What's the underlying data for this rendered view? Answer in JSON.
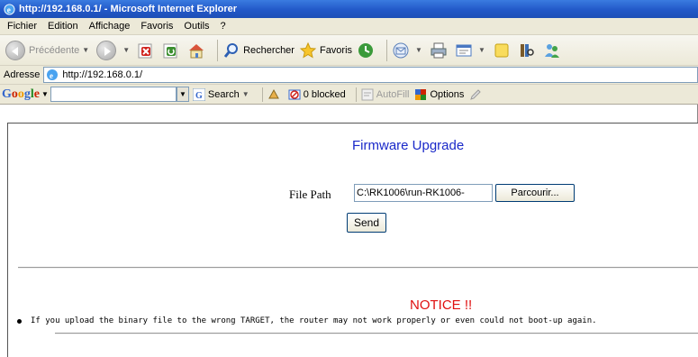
{
  "window": {
    "title": "http://192.168.0.1/ - Microsoft Internet Explorer"
  },
  "menu": {
    "items": [
      "Fichier",
      "Edition",
      "Affichage",
      "Favoris",
      "Outils",
      "?"
    ]
  },
  "toolbar": {
    "back_label": "Précédente",
    "search_label": "Rechercher",
    "favorites_label": "Favoris"
  },
  "address": {
    "label": "Adresse",
    "url": "http://192.168.0.1/"
  },
  "google_bar": {
    "logo": "Google",
    "search_label": "Search",
    "blocked_label": "0 blocked",
    "autofill_label": "AutoFill",
    "options_label": "Options"
  },
  "page": {
    "title": "Firmware Upgrade",
    "file_path_label": "File Path",
    "file_path_value": "C:\\RK1006\\run-RK1006-",
    "browse_label": "Parcourir...",
    "send_label": "Send",
    "notice_title": "NOTICE !!",
    "notice_text": "If you upload the binary file to the wrong TARGET, the router may not work properly or even could not boot-up again."
  },
  "colors": {
    "title_blue": "#1a29c9",
    "notice_red": "#e01010"
  }
}
